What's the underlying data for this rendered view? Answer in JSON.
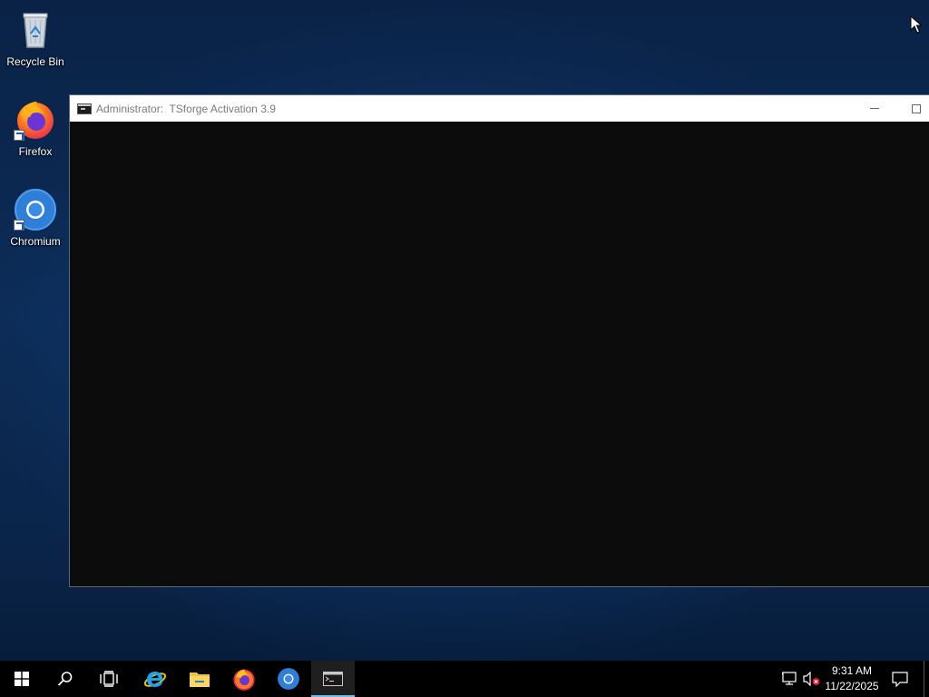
{
  "desktop": {
    "icons": [
      {
        "label": "Recycle Bin",
        "icon": "recycle-bin-icon"
      },
      {
        "label": "Firefox",
        "icon": "firefox-icon"
      },
      {
        "label": "Chromium",
        "icon": "chromium-icon"
      }
    ]
  },
  "window": {
    "title": "Administrator:  TSforge Activation 3.9",
    "icon": "console-icon",
    "controls": {
      "minimize": "minimize-icon",
      "maximize": "maximize-icon"
    },
    "console_text": ""
  },
  "taskbar": {
    "buttons": [
      {
        "name": "start",
        "icon": "windows-logo-icon"
      },
      {
        "name": "search",
        "icon": "search-icon"
      },
      {
        "name": "task-view",
        "icon": "task-view-icon"
      },
      {
        "name": "internet-explorer",
        "icon": "internet-explorer-icon"
      },
      {
        "name": "file-explorer",
        "icon": "folder-icon"
      },
      {
        "name": "firefox",
        "icon": "firefox-icon"
      },
      {
        "name": "chromium",
        "icon": "chromium-icon"
      },
      {
        "name": "console",
        "icon": "console-icon",
        "active": true
      }
    ],
    "tray": {
      "network_icon": "network-icon",
      "volume_icon": "volume-muted-icon",
      "time": "9:31 AM",
      "date": "11/22/2025",
      "notification_icon": "action-center-icon"
    }
  },
  "colors": {
    "console_bg": "#0c0c0c",
    "titlebar_bg": "#ffffff",
    "taskbar_bg": "#000000",
    "active_indicator": "#76b9ed"
  }
}
